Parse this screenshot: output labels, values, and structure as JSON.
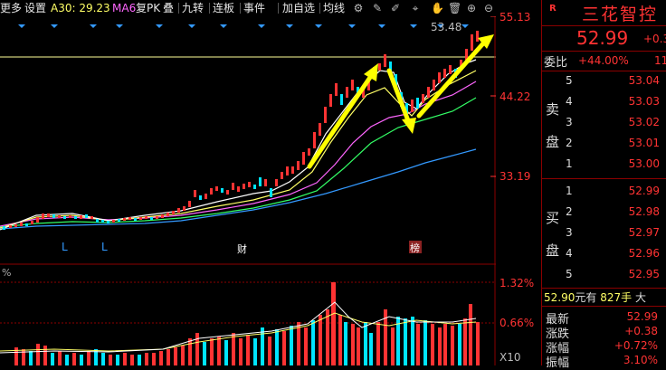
{
  "toolbar": {
    "more": "更多",
    "settings": "设置",
    "ma30": "A30: 29.23",
    "ma60": "MA6",
    "replay": "复",
    "pk": "PK",
    "overlay": "叠",
    "nine_turn": "九转",
    "limit_up": "连板",
    "events": "事件",
    "add_self": "加自选",
    "draw": "均线"
  },
  "chart": {
    "price_axis": [
      "55.13",
      "44.22",
      "33.19"
    ],
    "high_label": "53.48",
    "markers": [
      "L",
      "L",
      "财",
      "榜"
    ],
    "volume_axis": [
      "1.32%",
      "0.66%"
    ],
    "volume_scale": "X10",
    "volume_title": "%"
  },
  "stock": {
    "title": "三花智控",
    "tag": "R",
    "price": "52.99",
    "change": "+0.3",
    "weibi_label": "委比",
    "weibi_value": "+44.00%",
    "weibi_extra": "11",
    "sell_label_top": "卖",
    "sell_label_bottom": "盘",
    "buy_label_top": "买",
    "buy_label_bottom": "盘",
    "sell": [
      {
        "level": "5",
        "price": "53.04"
      },
      {
        "level": "4",
        "price": "53.03"
      },
      {
        "level": "3",
        "price": "53.02"
      },
      {
        "level": "2",
        "price": "53.01"
      },
      {
        "level": "1",
        "price": "53.00"
      }
    ],
    "buy": [
      {
        "level": "1",
        "price": "52.99"
      },
      {
        "level": "2",
        "price": "52.98"
      },
      {
        "level": "3",
        "price": "52.97"
      },
      {
        "level": "4",
        "price": "52.96"
      },
      {
        "level": "5",
        "price": "52.95"
      }
    ],
    "trade_price": "52.90",
    "trade_note": "元有",
    "trade_qty": "827手",
    "trade_side": "大",
    "latest_label": "最新",
    "latest_value": "52.99",
    "change_label": "涨跌",
    "change_value": "+0.38",
    "pct_label": "涨幅",
    "pct_value": "+0.72%",
    "amp_label": "振幅",
    "amp_value": "3.10%"
  },
  "colors": {
    "up": "#ff3333",
    "down": "#00e5ff",
    "ma_white": "#ffffff",
    "ma_yellow": "#ffff66",
    "ma_magenta": "#ff66ff",
    "ma_green": "#33ff66",
    "ma_blue": "#3399ff",
    "arrow": "#ffff00",
    "grid": "#8b0000"
  }
}
